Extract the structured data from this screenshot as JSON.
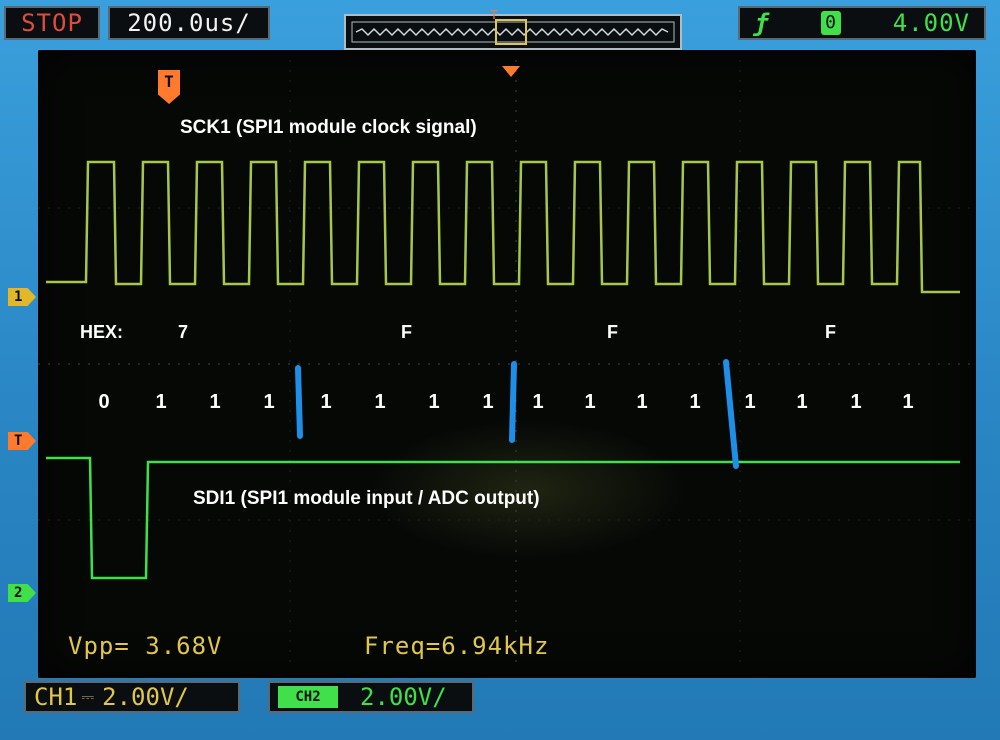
{
  "header": {
    "run_status": "STOP",
    "timebase": "200.0us/",
    "trigger": {
      "edge_icon": "rising-edge-icon",
      "source": "0",
      "level": "4.00V"
    }
  },
  "markers": {
    "trigger_top": "T",
    "trigger_pos": "T",
    "ch1": "1",
    "trigger_level": "T",
    "ch2": "2"
  },
  "annotations": {
    "sck_label": "SCK1 (SPI1 module clock signal)",
    "sdi_label": "SDI1 (SPI1 module input / ADC output)",
    "hex_label": "HEX:",
    "hex_digits": [
      "7",
      "F",
      "F",
      "F"
    ],
    "bits": [
      "0",
      "1",
      "1",
      "1",
      "1",
      "1",
      "1",
      "1",
      "1",
      "1",
      "1",
      "1",
      "1",
      "1",
      "1",
      "1"
    ]
  },
  "measurements": {
    "vpp": "Vpp= 3.68V",
    "freq": "Freq=6.94kHz"
  },
  "channels": {
    "ch1": {
      "label": "CH1",
      "coupling": "⎓",
      "scale": "2.00V/"
    },
    "ch2": {
      "badge": "CH2",
      "scale": "2.00V/"
    }
  },
  "colors": {
    "ch1_trace": "#a7c64a",
    "ch2_trace": "#3fe04a",
    "annotation_mark": "#1e8fe8",
    "trigger_marker": "#ff7a2c",
    "ch1_marker": "#e0b82a"
  }
}
